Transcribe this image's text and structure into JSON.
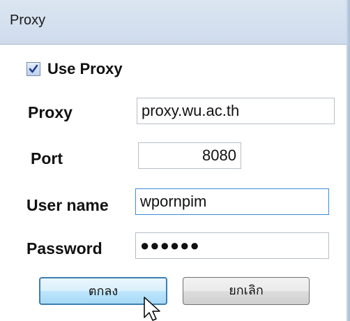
{
  "window": {
    "title": "Proxy"
  },
  "use_proxy": {
    "label": "Use Proxy",
    "checked": true
  },
  "fields": {
    "proxy": {
      "label": "Proxy",
      "value": "proxy.wu.ac.th"
    },
    "port": {
      "label": "Port",
      "value": "8080"
    },
    "username": {
      "label": "User name",
      "value": "wpornpim"
    },
    "password": {
      "label": "Password",
      "value": "●●●●●●"
    }
  },
  "buttons": {
    "ok_label": "ตกลง",
    "cancel_label": "ยกเลิก"
  },
  "icons": {
    "checkbox_check": "checkmark-icon",
    "mouse_pointer": "mouse-pointer-icon"
  },
  "colors": {
    "titlebar": "#dbe5f1",
    "focus_border": "#3c8ce0",
    "ok_button_border": "#3c7fb1"
  }
}
